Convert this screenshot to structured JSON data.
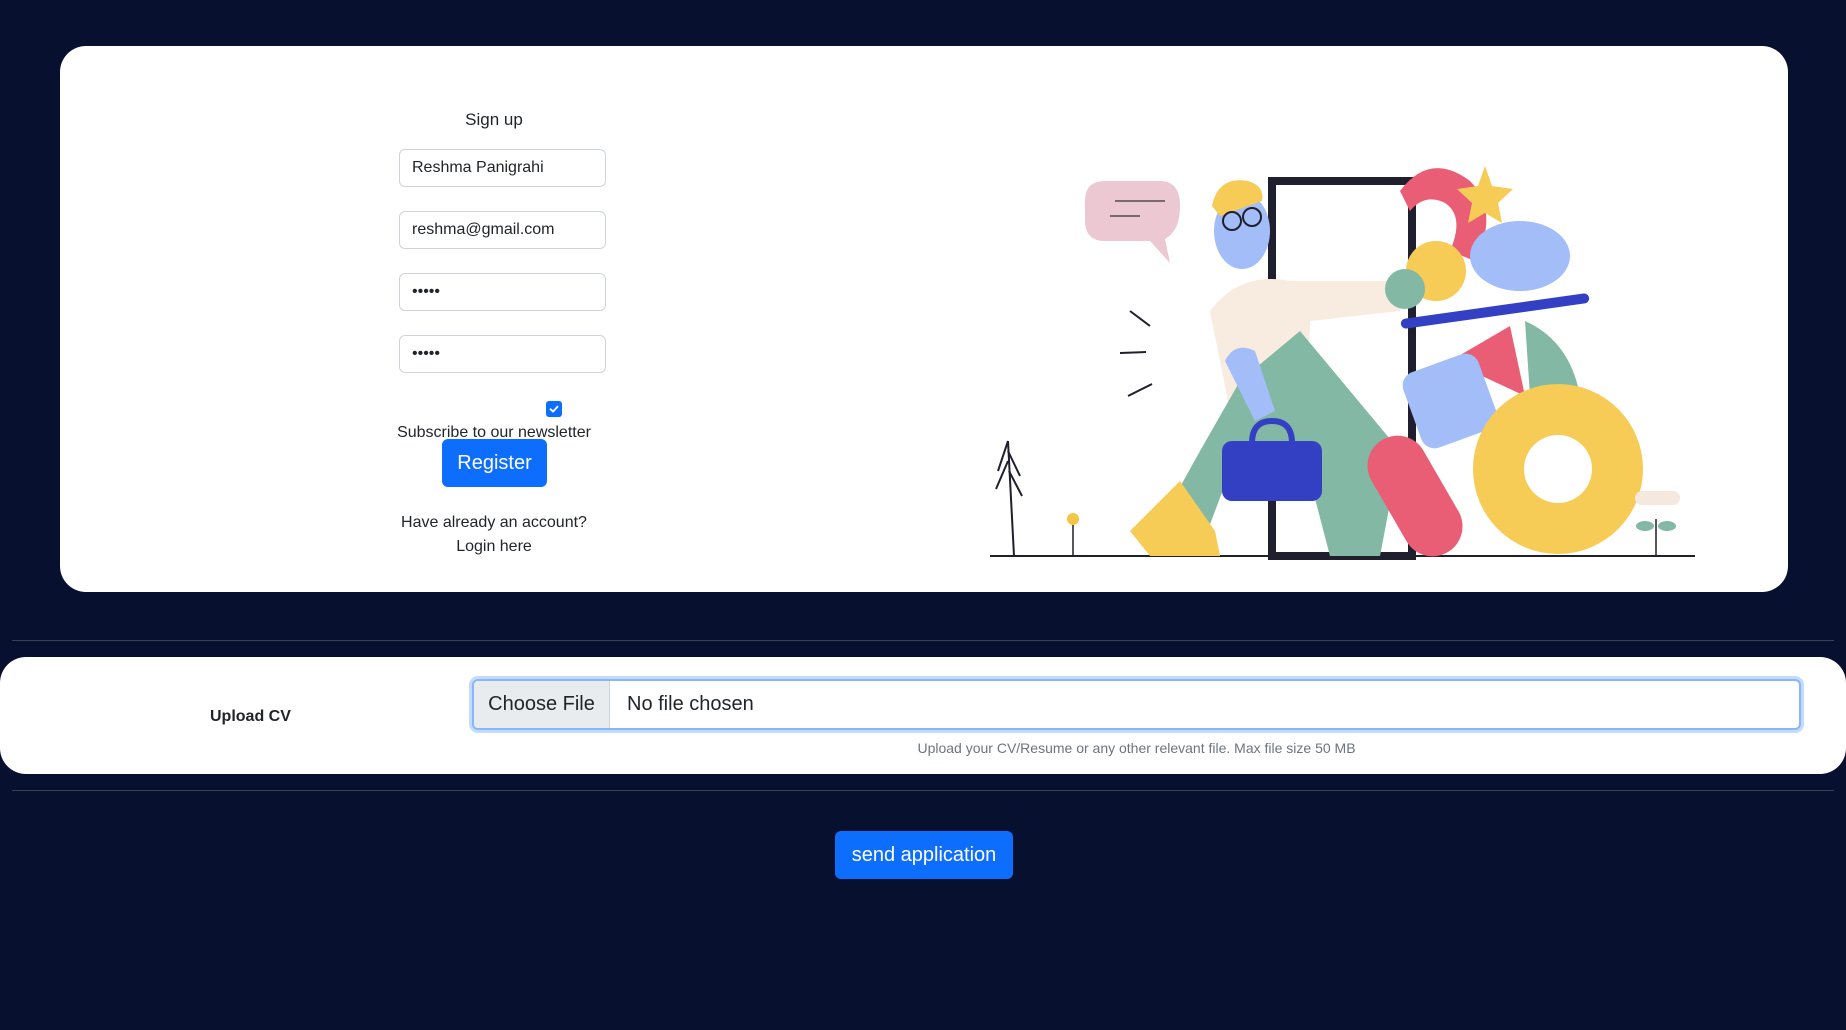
{
  "signup": {
    "title": "Sign up",
    "name_value": "Reshma Panigrahi",
    "email_value": "reshma@gmail.com",
    "password_value": "•••••",
    "repeat_password_value": "•••••",
    "newsletter_label": "Subscribe to our newsletter",
    "newsletter_checked": true,
    "register_label": "Register",
    "have_account_text": "Have already an account?",
    "login_link": "Login here"
  },
  "upload": {
    "label": "Upload CV",
    "choose_file_label": "Choose File",
    "file_status": "No file chosen",
    "help_text": "Upload your CV/Resume or any other relevant file. Max file size 50 MB"
  },
  "actions": {
    "send_label": "send application"
  },
  "colors": {
    "background": "#081030",
    "card": "#ffffff",
    "primary": "#0d6efd"
  }
}
